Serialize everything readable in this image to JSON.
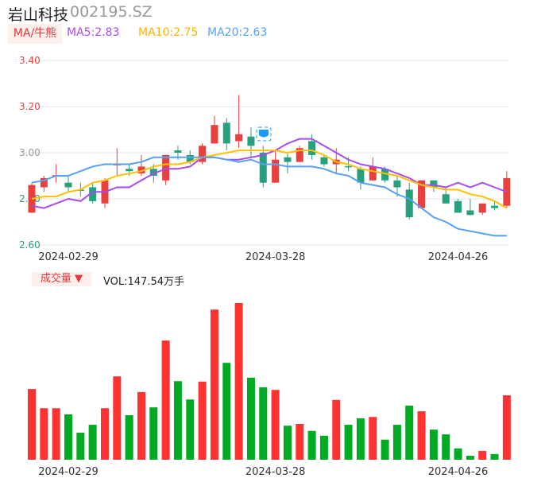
{
  "header": {
    "name": "岩山科技",
    "code": "002195.SZ",
    "ma_tag": "MA/牛熊",
    "ma5": "MA5:2.83",
    "ma10": "MA10:2.75",
    "ma20": "MA20:2.63"
  },
  "volume_header": {
    "tag": "成交量 ▼",
    "value": "VOL:147.54万手"
  },
  "colors": {
    "up": "#e8403f",
    "down": "#26a07e",
    "vol_up": "#ff3232",
    "vol_down": "#00aa22",
    "ma5": "#a64bf4",
    "ma10": "#ffc000",
    "ma20": "#55a2f5"
  },
  "chart_data": [
    {
      "type": "candlestick",
      "ylim": [
        2.6,
        3.4
      ],
      "yticks": [
        "3.40",
        "3.20",
        "3.00",
        "2.80",
        "2.60"
      ],
      "grid": true,
      "xticks": [
        {
          "index": 3,
          "label": "2024-02-29"
        },
        {
          "index": 20,
          "label": "2024-03-28"
        },
        {
          "index": 35,
          "label": "2024-04-26"
        }
      ],
      "ohlc": [
        [
          2.74,
          2.86,
          2.87,
          2.74
        ],
        [
          2.85,
          2.89,
          2.9,
          2.83
        ],
        [
          2.897,
          2.903,
          2.95,
          2.87
        ],
        [
          2.87,
          2.85,
          2.9,
          2.83
        ],
        [
          2.84,
          2.839,
          2.87,
          2.81
        ],
        [
          2.85,
          2.79,
          2.87,
          2.78
        ],
        [
          2.78,
          2.88,
          2.89,
          2.76
        ],
        [
          2.945,
          2.952,
          3.02,
          2.9
        ],
        [
          2.93,
          2.92,
          2.95,
          2.9
        ],
        [
          2.91,
          2.94,
          2.99,
          2.9
        ],
        [
          2.93,
          2.9,
          2.95,
          2.87
        ],
        [
          2.88,
          2.99,
          2.99,
          2.86
        ],
        [
          3.01,
          3.0,
          3.03,
          2.97
        ],
        [
          2.99,
          2.96,
          3.01,
          2.95
        ],
        [
          2.96,
          3.03,
          3.04,
          2.95
        ],
        [
          3.04,
          3.12,
          3.16,
          3.04
        ],
        [
          3.13,
          3.04,
          3.15,
          3.01
        ],
        [
          3.05,
          3.08,
          3.25,
          3.02
        ],
        [
          3.07,
          3.03,
          3.11,
          2.98
        ],
        [
          3.0,
          2.87,
          3.03,
          2.85
        ],
        [
          2.87,
          2.97,
          3.01,
          2.87
        ],
        [
          2.98,
          2.96,
          3.0,
          2.91
        ],
        [
          2.96,
          3.02,
          3.03,
          2.96
        ],
        [
          3.05,
          2.99,
          3.08,
          2.97
        ],
        [
          2.98,
          2.95,
          2.99,
          2.94
        ],
        [
          2.95,
          2.97,
          3.02,
          2.91
        ],
        [
          2.942,
          2.939,
          2.98,
          2.92
        ],
        [
          2.93,
          2.87,
          2.94,
          2.84
        ],
        [
          2.88,
          2.94,
          2.98,
          2.88
        ],
        [
          2.93,
          2.88,
          2.94,
          2.87
        ],
        [
          2.88,
          2.85,
          2.9,
          2.81
        ],
        [
          2.84,
          2.72,
          2.87,
          2.71
        ],
        [
          2.76,
          2.88,
          2.88,
          2.76
        ],
        [
          2.88,
          2.85,
          2.88,
          2.83
        ],
        [
          2.82,
          2.78,
          2.85,
          2.78
        ],
        [
          2.79,
          2.74,
          2.8,
          2.74
        ],
        [
          2.75,
          2.73,
          2.8,
          2.73
        ],
        [
          2.74,
          2.78,
          2.78,
          2.73
        ],
        [
          2.77,
          2.76,
          2.79,
          2.75
        ],
        [
          2.77,
          2.89,
          2.92,
          2.76
        ]
      ],
      "series": [
        {
          "name": "MA5",
          "values": [
            2.77,
            2.76,
            2.78,
            2.8,
            2.79,
            2.83,
            2.83,
            2.85,
            2.85,
            2.88,
            2.91,
            2.93,
            2.93,
            2.94,
            2.98,
            2.98,
            2.97,
            2.97,
            2.98,
            2.99,
            3.01,
            3.04,
            3.06,
            3.06,
            3.03,
            3.0,
            2.97,
            2.95,
            2.94,
            2.93,
            2.91,
            2.89,
            2.86,
            2.86,
            2.85,
            2.87,
            2.85,
            2.87,
            2.85,
            2.83
          ]
        },
        {
          "name": "MA10",
          "values": [
            2.8,
            2.81,
            2.81,
            2.83,
            2.84,
            2.87,
            2.88,
            2.9,
            2.91,
            2.92,
            2.94,
            2.95,
            2.95,
            2.96,
            2.98,
            2.99,
            3.0,
            3.01,
            3.01,
            3.01,
            3.01,
            3.0,
            3.01,
            3.01,
            2.99,
            2.96,
            2.95,
            2.93,
            2.92,
            2.91,
            2.9,
            2.88,
            2.86,
            2.85,
            2.84,
            2.84,
            2.82,
            2.81,
            2.79,
            2.76
          ]
        },
        {
          "name": "MA20",
          "values": [
            2.87,
            2.88,
            2.9,
            2.9,
            2.92,
            2.94,
            2.95,
            2.95,
            2.95,
            2.96,
            2.98,
            2.98,
            2.98,
            2.98,
            2.98,
            2.98,
            2.97,
            2.96,
            2.97,
            2.95,
            2.95,
            2.94,
            2.94,
            2.94,
            2.93,
            2.91,
            2.9,
            2.87,
            2.86,
            2.85,
            2.82,
            2.8,
            2.76,
            2.72,
            2.7,
            2.67,
            2.66,
            2.65,
            2.64,
            2.64
          ]
        }
      ]
    },
    {
      "type": "bar",
      "unit": "万手",
      "values": [
        162,
        118,
        118,
        104,
        62,
        80,
        118,
        191,
        102,
        155,
        120,
        273,
        180,
        138,
        179,
        344,
        222,
        359,
        188,
        166,
        160,
        78,
        82,
        66,
        55,
        137,
        80,
        95,
        98,
        46,
        80,
        124,
        111,
        69,
        58,
        26,
        9,
        20,
        13,
        147.54
      ],
      "xticks": [
        {
          "index": 3,
          "label": "2024-02-29"
        },
        {
          "index": 20,
          "label": "2024-03-28"
        },
        {
          "index": 35,
          "label": "2024-04-26"
        }
      ]
    }
  ]
}
